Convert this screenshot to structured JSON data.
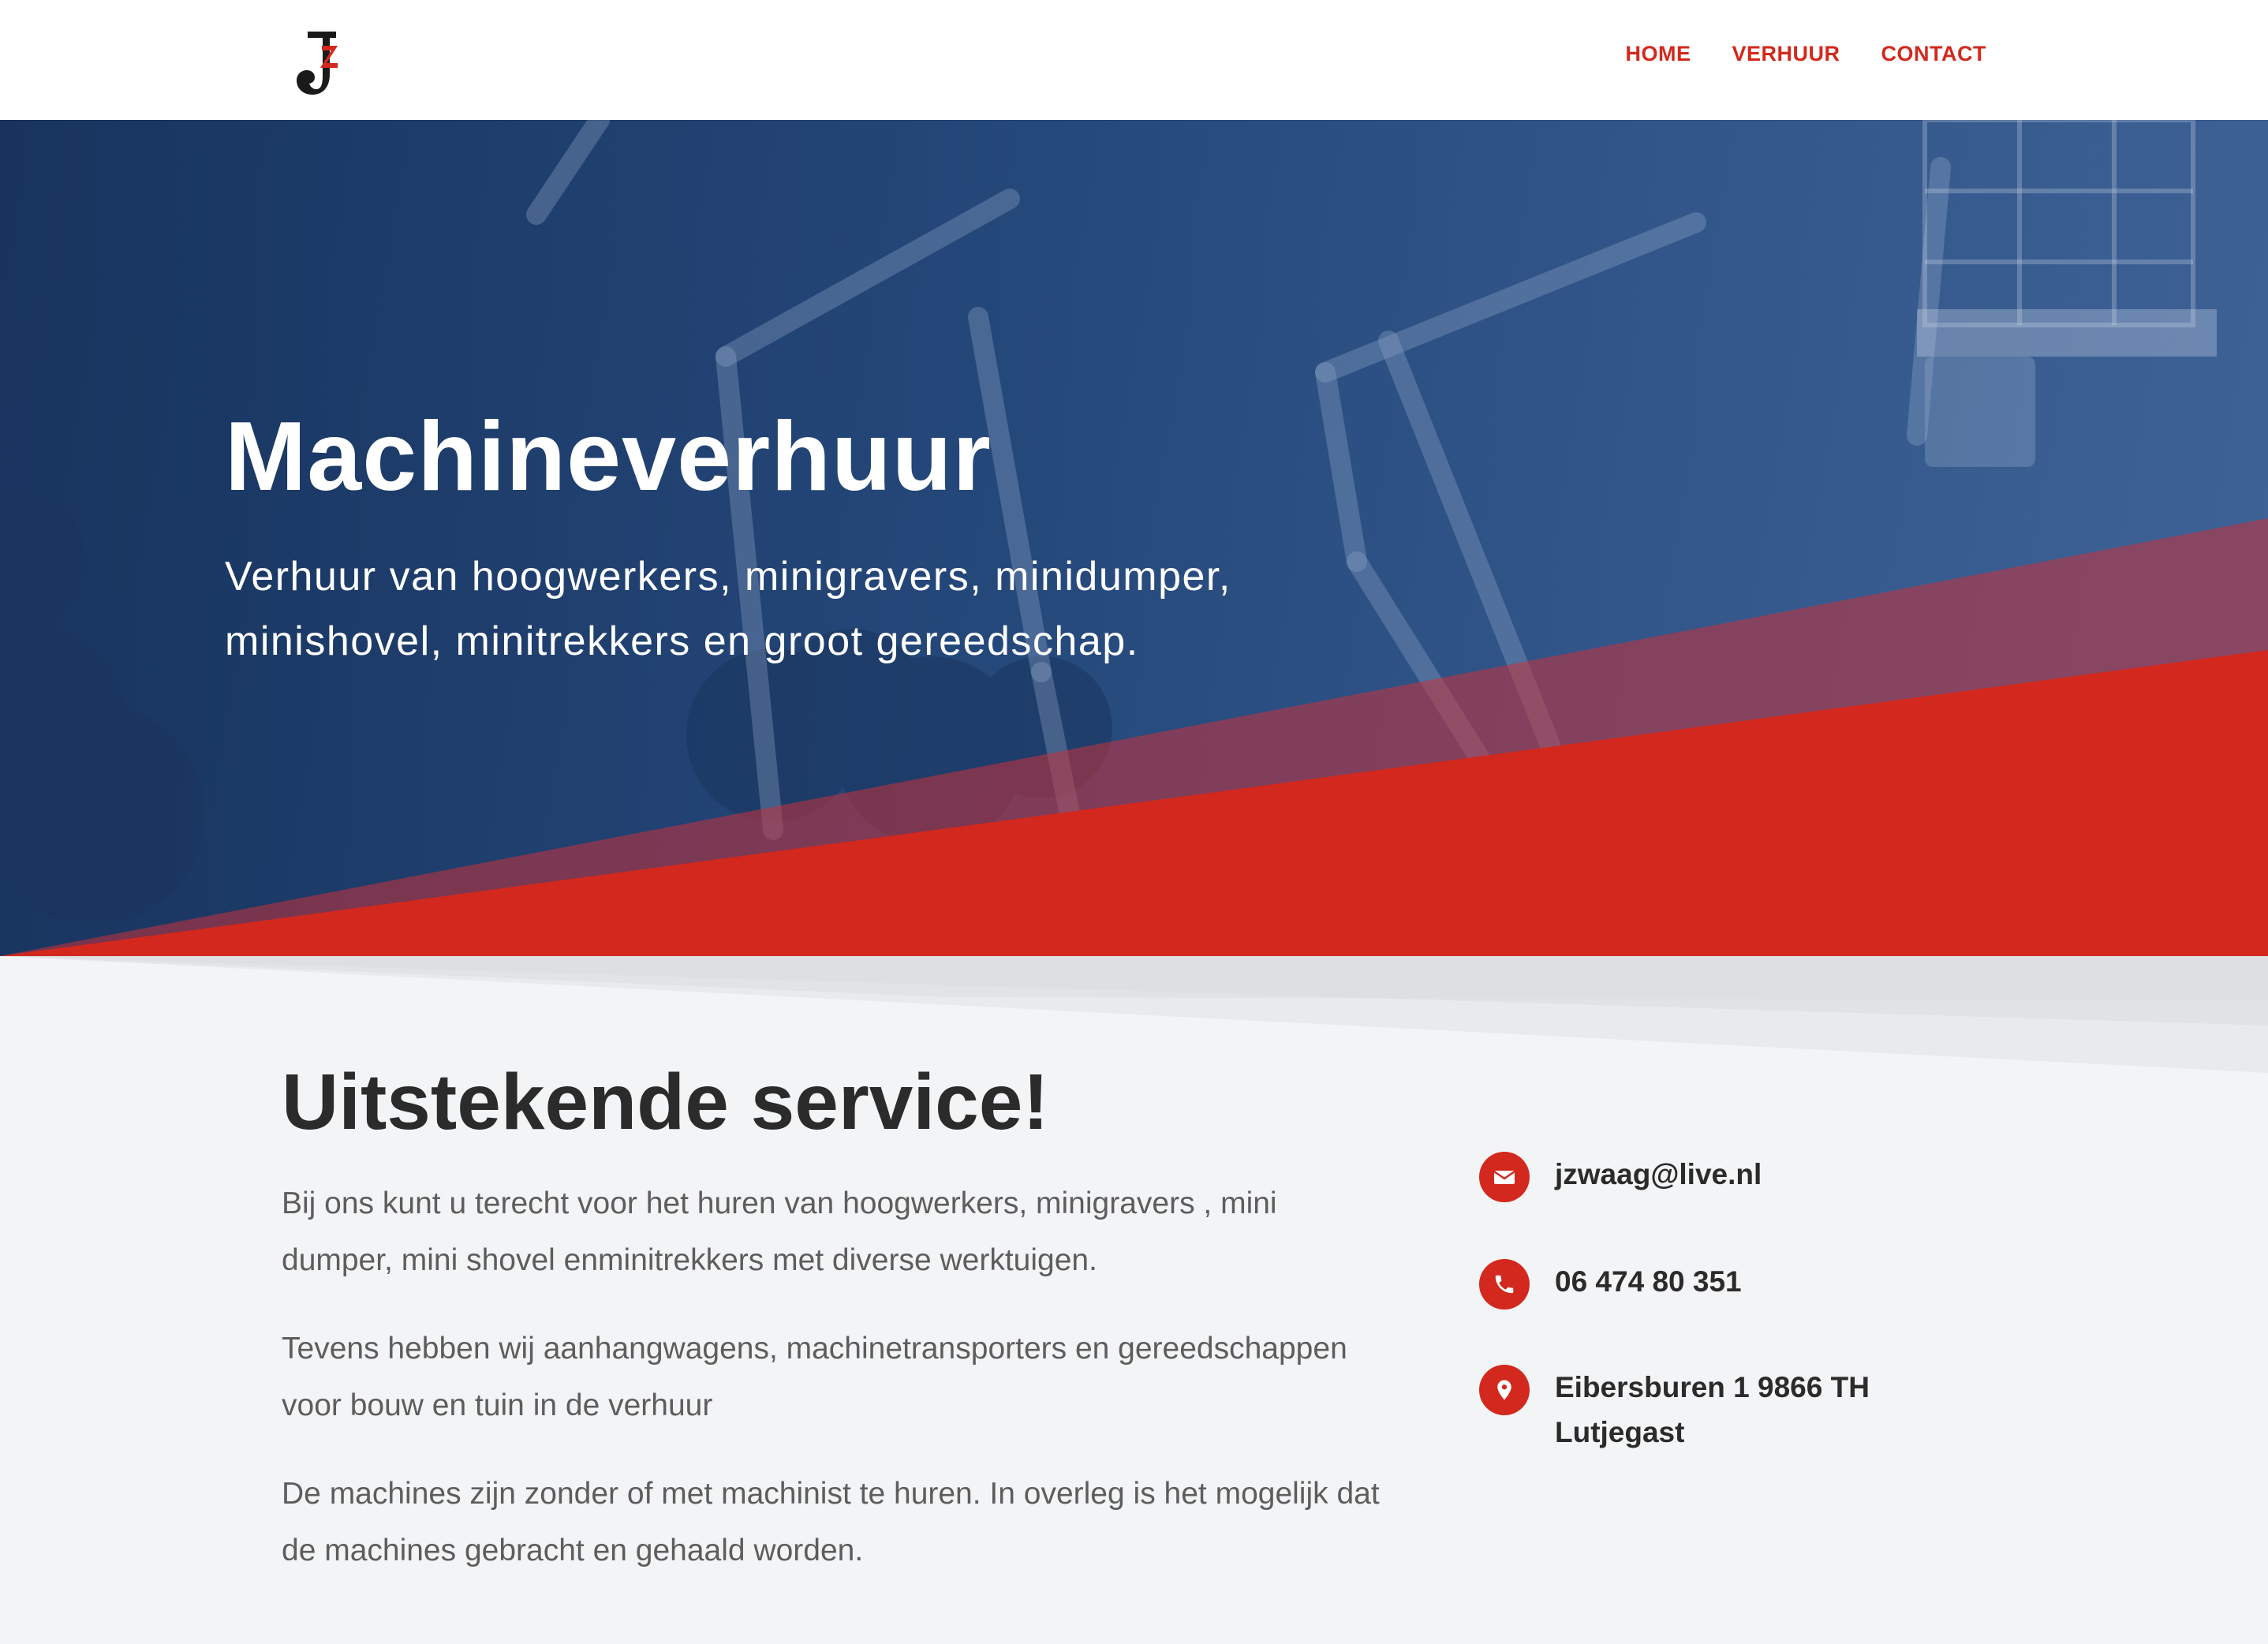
{
  "header": {
    "logo_alt": "JZ",
    "nav": {
      "home": "HOME",
      "verhuur": "VERHUUR",
      "contact": "CONTACT"
    }
  },
  "hero": {
    "title": "Machineverhuur",
    "subtitle": "Verhuur van hoogwerkers, minigravers, minidumper, minishovel, minitrekkers en groot gereedschap."
  },
  "main": {
    "heading": "Uitstekende service!",
    "paragraphs": [
      "Bij ons kunt u terecht voor het huren van hoogwerkers, minigravers , mini dumper, mini shovel enminitrekkers met diverse werktuigen.",
      "Tevens hebben wij aanhangwagens, machinetransporters en gereedschappen voor bouw en tuin in de verhuur",
      "De machines zijn zonder of met machinist te huren. In overleg is het mogelijk dat de machines gebracht en gehaald worden."
    ]
  },
  "contact": {
    "email": "jzwaag@live.nl",
    "phone": "06 474 80 351",
    "address": "Eibersburen 1 9866 TH Lutjegast",
    "icons": {
      "email": "envelope-icon",
      "phone": "phone-icon",
      "address": "map-pin-icon"
    }
  },
  "colors": {
    "accent_red": "#d3281d",
    "hero_blue": "#1c3a66",
    "text_dark": "#2b2b2b",
    "text_body": "#5d5d5d",
    "background": "#f3f4f6"
  }
}
